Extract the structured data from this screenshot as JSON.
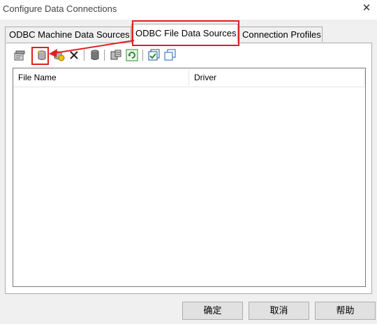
{
  "window": {
    "title": "Configure Data Connections",
    "close_symbol": "✕"
  },
  "tabs": [
    {
      "label": "ODBC Machine Data Sources",
      "active": false
    },
    {
      "label": "ODBC File Data Sources",
      "active": true
    },
    {
      "label": "Connection Profiles",
      "active": false
    }
  ],
  "toolbar": {
    "icons": [
      "properties-icon",
      "new-file-dsn-icon",
      "add-icon",
      "delete-icon",
      "database-icon",
      "driver-icon",
      "refresh-icon",
      "select-icon",
      "copy-icon"
    ]
  },
  "list": {
    "columns": [
      "File Name",
      "Driver"
    ],
    "rows": []
  },
  "buttons": {
    "ok": "确定",
    "cancel": "取消",
    "help": "帮助"
  },
  "colors": {
    "highlight": "#e02020",
    "accent_green": "#2e8b2e",
    "accent_blue": "#2060c0"
  }
}
